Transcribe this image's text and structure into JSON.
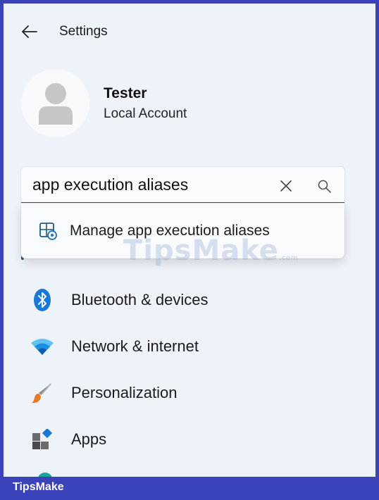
{
  "header": {
    "title": "Settings"
  },
  "profile": {
    "name": "Tester",
    "account_type": "Local Account"
  },
  "search": {
    "value": "app execution aliases"
  },
  "suggestions": [
    {
      "label": "Manage app execution aliases"
    }
  ],
  "nav": {
    "items": [
      {
        "label": "Bluetooth & devices",
        "icon": "bluetooth-icon"
      },
      {
        "label": "Network & internet",
        "icon": "wifi-icon"
      },
      {
        "label": "Personalization",
        "icon": "brush-icon"
      },
      {
        "label": "Apps",
        "icon": "apps-icon"
      }
    ]
  },
  "watermark": {
    "text": "TipsMake",
    "suffix": ".com"
  },
  "footer": {
    "brand": "TipsMake"
  },
  "colors": {
    "accent": "#1f5a86",
    "frame": "#3a43b8",
    "background": "#eef3f9"
  }
}
